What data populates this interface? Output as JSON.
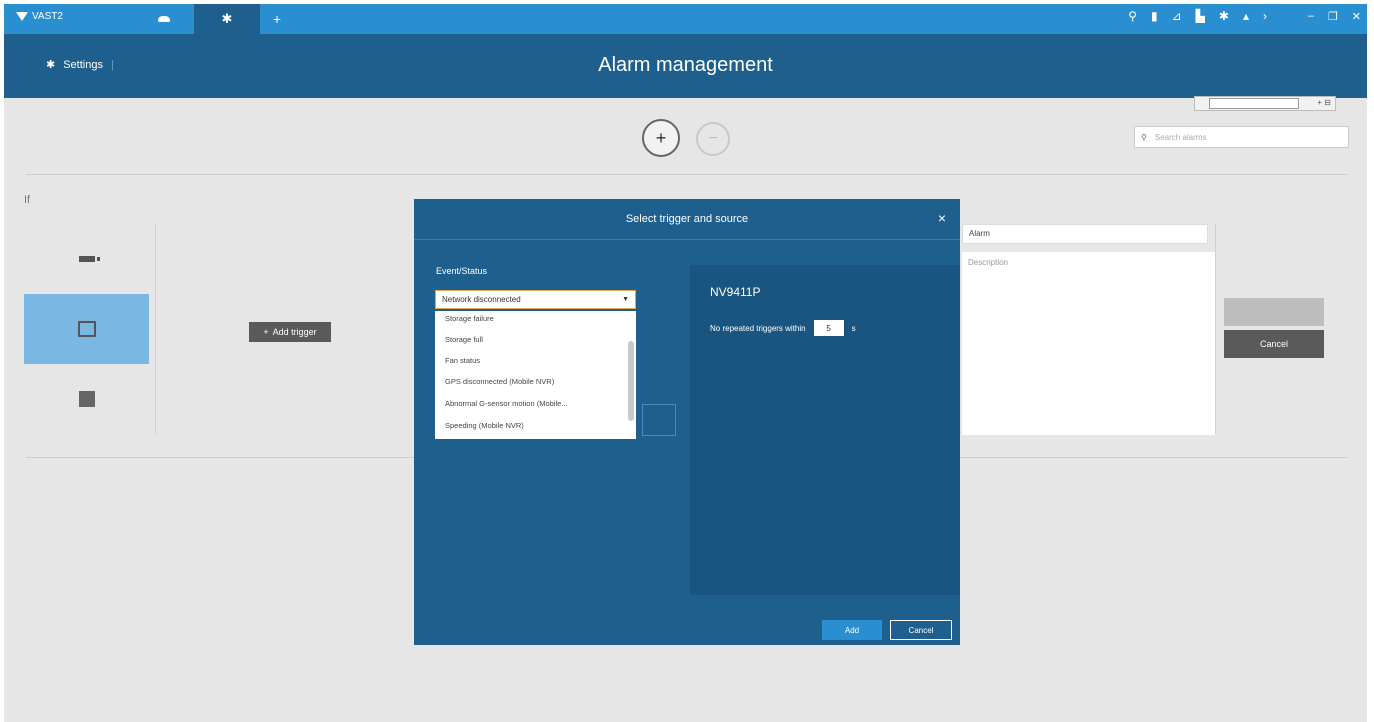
{
  "topbar": {
    "brand_label": "VAST2",
    "icons": [
      "cloud-icon",
      "gear-icon",
      "plus-icon",
      "link-icon",
      "book-icon",
      "chart-icon",
      "user-icon",
      "gear-icon",
      "alert-icon",
      "chevron-icon"
    ],
    "win_min": "–",
    "win_max": "❐",
    "win_close": "✕"
  },
  "header": {
    "settings_label": "Settings",
    "title": "Alarm management"
  },
  "toolbar": {
    "add_icon": "+",
    "remove_icon": "−",
    "search_placeholder": "Search alarms",
    "mini_ctl": "+ ⊟"
  },
  "left": {
    "if_label": "If",
    "add_trigger_label": "Add trigger"
  },
  "form": {
    "name_value": "Alarm",
    "description_placeholder": "Description",
    "cancel_label": "Cancel"
  },
  "modal": {
    "title": "Select trigger and source",
    "close": "×",
    "event_label": "Event/Status",
    "selected": "Network disconnected",
    "options": [
      "Storage failure",
      "Storage full",
      "Fan status",
      "GPS disconnected (Mobile NVR)",
      "Abnormal G-sensor motion (Mobile...",
      "Speeding (Mobile NVR)"
    ],
    "device_name": "NV9411P",
    "no_repeat_label": "No repeated triggers within",
    "no_repeat_value": "5",
    "no_repeat_unit": "s",
    "add_label": "Add",
    "cancel_label": "Cancel"
  }
}
